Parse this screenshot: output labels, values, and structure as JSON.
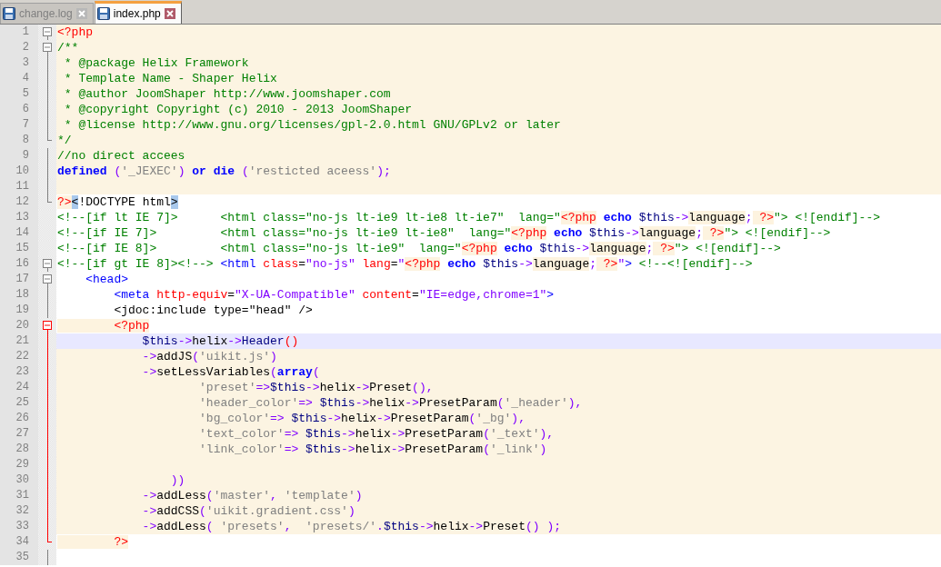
{
  "tabs": [
    {
      "label": "change.log",
      "selected": false
    },
    {
      "label": "index.php",
      "selected": true
    }
  ],
  "lines": [
    {
      "number": "1",
      "kind": "fold-start",
      "fold_active": false,
      "php_block": true,
      "current": false,
      "tokens": [
        {
          "kind": "php-tag",
          "text": "<?php"
        }
      ]
    },
    {
      "number": "2",
      "kind": "fold-start",
      "fold_active": false,
      "php_block": true,
      "current": false,
      "tokens": [
        {
          "kind": "comment",
          "text": "/**"
        }
      ]
    },
    {
      "number": "3",
      "kind": "fold-body",
      "fold_active": false,
      "php_block": true,
      "current": false,
      "tokens": [
        {
          "kind": "comment",
          "text": " * @package Helix Framework"
        }
      ]
    },
    {
      "number": "4",
      "kind": "fold-body",
      "fold_active": false,
      "php_block": true,
      "current": false,
      "tokens": [
        {
          "kind": "comment",
          "text": " * Template Name - Shaper Helix"
        }
      ]
    },
    {
      "number": "5",
      "kind": "fold-body",
      "fold_active": false,
      "php_block": true,
      "current": false,
      "tokens": [
        {
          "kind": "comment",
          "text": " * @author JoomShaper http://www.joomshaper.com"
        }
      ]
    },
    {
      "number": "6",
      "kind": "fold-body",
      "fold_active": false,
      "php_block": true,
      "current": false,
      "tokens": [
        {
          "kind": "comment",
          "text": " * @copyright Copyright (c) 2010 - 2013 JoomShaper"
        }
      ]
    },
    {
      "number": "7",
      "kind": "fold-body",
      "fold_active": false,
      "php_block": true,
      "current": false,
      "tokens": [
        {
          "kind": "comment",
          "text": " * @license http://www.gnu.org/licenses/gpl-2.0.html GNU/GPLv2 or later"
        }
      ]
    },
    {
      "number": "8",
      "kind": "fold-end",
      "fold_active": false,
      "php_block": true,
      "current": false,
      "tokens": [
        {
          "kind": "comment",
          "text": "*/"
        }
      ]
    },
    {
      "number": "9",
      "kind": "fold-body",
      "fold_active": false,
      "php_block": true,
      "current": false,
      "tokens": [
        {
          "kind": "comment",
          "text": "//no direct accees"
        }
      ]
    },
    {
      "number": "10",
      "kind": "fold-body",
      "fold_active": false,
      "php_block": true,
      "current": false,
      "tokens": [
        {
          "kind": "keyword",
          "text": "defined"
        },
        {
          "kind": "operator",
          "text": " ("
        },
        {
          "kind": "string",
          "text": "'_JEXEC'"
        },
        {
          "kind": "operator",
          "text": ")"
        },
        {
          "kind": "keyword",
          "text": " or"
        },
        {
          "kind": "keyword",
          "text": " die"
        },
        {
          "kind": "operator",
          "text": " ("
        },
        {
          "kind": "string",
          "text": "'resticted aceess'"
        },
        {
          "kind": "operator",
          "text": ");"
        }
      ]
    },
    {
      "number": "11",
      "kind": "fold-body",
      "fold_active": false,
      "php_block": true,
      "current": false
    },
    {
      "number": "12",
      "kind": "fold-end",
      "fold_active": false,
      "php_block": false,
      "current": false,
      "tokens": [
        {
          "kind": "php-tag",
          "text": "?>"
        },
        {
          "kind": "bracket-match",
          "text": "<"
        },
        {
          "kind": "plain",
          "text": "!DOCTYPE html"
        },
        {
          "kind": "bracket-match",
          "text": ">"
        }
      ]
    },
    {
      "number": "13",
      "kind": "plain",
      "php_block": false,
      "current": false,
      "tokens": [
        {
          "kind": "comment",
          "text": "<!--[if lt IE 7]>      <html class=\"no-js lt-ie9 lt-ie8 lt-ie7\"  lang=\""
        },
        {
          "kind": "php-tag",
          "text": "<?php"
        },
        {
          "kind": "keyword",
          "text": " echo"
        },
        {
          "kind": "variable",
          "text": " $this"
        },
        {
          "kind": "operator",
          "text": "->"
        },
        {
          "kind": "embedded",
          "text": "language"
        },
        {
          "kind": "operator",
          "text": ";"
        },
        {
          "kind": "php-tag",
          "text": " ?>"
        },
        {
          "kind": "comment",
          "text": "\"> <![endif]-->"
        }
      ]
    },
    {
      "number": "14",
      "kind": "plain",
      "php_block": false,
      "current": false,
      "tokens": [
        {
          "kind": "comment",
          "text": "<!--[if IE 7]>         <html class=\"no-js lt-ie9 lt-ie8\"  lang=\""
        },
        {
          "kind": "php-tag",
          "text": "<?php"
        },
        {
          "kind": "keyword",
          "text": " echo"
        },
        {
          "kind": "variable",
          "text": " $this"
        },
        {
          "kind": "operator",
          "text": "->"
        },
        {
          "kind": "embedded",
          "text": "language"
        },
        {
          "kind": "operator",
          "text": ";"
        },
        {
          "kind": "php-tag",
          "text": " ?>"
        },
        {
          "kind": "comment",
          "text": "\"> <![endif]-->"
        }
      ]
    },
    {
      "number": "15",
      "kind": "plain",
      "php_block": false,
      "current": false,
      "tokens": [
        {
          "kind": "comment",
          "text": "<!--[if IE 8]>         <html class=\"no-js lt-ie9\"  lang=\""
        },
        {
          "kind": "php-tag",
          "text": "<?php"
        },
        {
          "kind": "keyword",
          "text": " echo"
        },
        {
          "kind": "variable",
          "text": " $this"
        },
        {
          "kind": "operator",
          "text": "->"
        },
        {
          "kind": "embedded",
          "text": "language"
        },
        {
          "kind": "operator",
          "text": ";"
        },
        {
          "kind": "php-tag",
          "text": " ?>"
        },
        {
          "kind": "comment",
          "text": "\"> <![endif]-->"
        }
      ]
    },
    {
      "number": "16",
      "kind": "fold-start",
      "fold_active": false,
      "php_block": false,
      "current": false,
      "tokens": [
        {
          "kind": "comment",
          "text": "<!--[if gt IE 8]><!-->"
        },
        {
          "kind": "html-tag",
          "text": " <html"
        },
        {
          "kind": "attr",
          "text": " class"
        },
        {
          "kind": "plain",
          "text": "="
        },
        {
          "kind": "attr-value",
          "text": "\"no-js\""
        },
        {
          "kind": "attr",
          "text": " lang"
        },
        {
          "kind": "plain",
          "text": "="
        },
        {
          "kind": "attr-value",
          "text": "\""
        },
        {
          "kind": "php-tag",
          "text": "<?php"
        },
        {
          "kind": "keyword",
          "text": " echo"
        },
        {
          "kind": "variable",
          "text": " $this"
        },
        {
          "kind": "operator",
          "text": "->"
        },
        {
          "kind": "embedded",
          "text": "language"
        },
        {
          "kind": "operator",
          "text": ";"
        },
        {
          "kind": "php-tag",
          "text": " ?>"
        },
        {
          "kind": "attr-value",
          "text": "\""
        },
        {
          "kind": "html-tag",
          "text": ">"
        },
        {
          "kind": "comment",
          "text": " <!--<![endif]-->"
        }
      ]
    },
    {
      "number": "17",
      "kind": "fold-start",
      "fold_active": false,
      "php_block": false,
      "current": false,
      "tokens": [
        {
          "kind": "html-tag",
          "text": "    <head>"
        }
      ]
    },
    {
      "number": "18",
      "kind": "fold-body",
      "fold_active": false,
      "php_block": false,
      "current": false,
      "tokens": [
        {
          "kind": "html-tag",
          "text": "        <meta"
        },
        {
          "kind": "attr",
          "text": " http-equiv"
        },
        {
          "kind": "plain",
          "text": "="
        },
        {
          "kind": "attr-value",
          "text": "\"X-UA-Compatible\""
        },
        {
          "kind": "attr",
          "text": " content"
        },
        {
          "kind": "plain",
          "text": "="
        },
        {
          "kind": "attr-value",
          "text": "\"IE=edge,chrome=1\""
        },
        {
          "kind": "html-tag",
          "text": ">"
        }
      ]
    },
    {
      "number": "19",
      "kind": "fold-body",
      "fold_active": false,
      "php_block": false,
      "current": false,
      "tokens": [
        {
          "kind": "plain",
          "text": "        <jdoc:include type=\"head\" />"
        }
      ]
    },
    {
      "number": "20",
      "kind": "fold-start",
      "fold_active": true,
      "php_block": false,
      "current": false,
      "tokens": [
        {
          "kind": "php-tag",
          "text": "        <?php"
        }
      ]
    },
    {
      "number": "21",
      "kind": "fold-body",
      "fold_active": true,
      "php_block": true,
      "current": true,
      "tokens": [
        {
          "kind": "variable",
          "text": "            $this"
        },
        {
          "kind": "operator",
          "text": "->"
        },
        {
          "kind": "plain",
          "text": "helix"
        },
        {
          "kind": "operator",
          "text": "->"
        },
        {
          "kind": "variable",
          "text": "Header"
        },
        {
          "kind": "brace-match",
          "text": "()"
        }
      ]
    },
    {
      "number": "22",
      "kind": "fold-body",
      "fold_active": true,
      "php_block": true,
      "current": false,
      "tokens": [
        {
          "kind": "operator",
          "text": "            ->"
        },
        {
          "kind": "plain",
          "text": "addJS"
        },
        {
          "kind": "operator",
          "text": "("
        },
        {
          "kind": "string",
          "text": "'uikit.js'"
        },
        {
          "kind": "operator",
          "text": ")"
        }
      ]
    },
    {
      "number": "23",
      "kind": "fold-body",
      "fold_active": true,
      "php_block": true,
      "current": false,
      "tokens": [
        {
          "kind": "operator",
          "text": "            ->"
        },
        {
          "kind": "plain",
          "text": "setLessVariables"
        },
        {
          "kind": "operator",
          "text": "("
        },
        {
          "kind": "keyword",
          "text": "array"
        },
        {
          "kind": "operator",
          "text": "("
        }
      ]
    },
    {
      "number": "24",
      "kind": "fold-body",
      "fold_active": true,
      "php_block": true,
      "current": false,
      "tokens": [
        {
          "kind": "string",
          "text": "                    'preset'"
        },
        {
          "kind": "operator",
          "text": "=>"
        },
        {
          "kind": "variable",
          "text": "$this"
        },
        {
          "kind": "operator",
          "text": "->"
        },
        {
          "kind": "plain",
          "text": "helix"
        },
        {
          "kind": "operator",
          "text": "->"
        },
        {
          "kind": "plain",
          "text": "Preset"
        },
        {
          "kind": "operator",
          "text": "(),"
        }
      ]
    },
    {
      "number": "25",
      "kind": "fold-body",
      "fold_active": true,
      "php_block": true,
      "current": false,
      "tokens": [
        {
          "kind": "string",
          "text": "                    'header_color'"
        },
        {
          "kind": "operator",
          "text": "=>"
        },
        {
          "kind": "variable",
          "text": " $this"
        },
        {
          "kind": "operator",
          "text": "->"
        },
        {
          "kind": "plain",
          "text": "helix"
        },
        {
          "kind": "operator",
          "text": "->"
        },
        {
          "kind": "plain",
          "text": "PresetParam"
        },
        {
          "kind": "operator",
          "text": "("
        },
        {
          "kind": "string",
          "text": "'_header'"
        },
        {
          "kind": "operator",
          "text": "),"
        }
      ]
    },
    {
      "number": "26",
      "kind": "fold-body",
      "fold_active": true,
      "php_block": true,
      "current": false,
      "tokens": [
        {
          "kind": "string",
          "text": "                    'bg_color'"
        },
        {
          "kind": "operator",
          "text": "=>"
        },
        {
          "kind": "variable",
          "text": " $this"
        },
        {
          "kind": "operator",
          "text": "->"
        },
        {
          "kind": "plain",
          "text": "helix"
        },
        {
          "kind": "operator",
          "text": "->"
        },
        {
          "kind": "plain",
          "text": "PresetParam"
        },
        {
          "kind": "operator",
          "text": "("
        },
        {
          "kind": "string",
          "text": "'_bg'"
        },
        {
          "kind": "operator",
          "text": "),"
        }
      ]
    },
    {
      "number": "27",
      "kind": "fold-body",
      "fold_active": true,
      "php_block": true,
      "current": false,
      "tokens": [
        {
          "kind": "string",
          "text": "                    'text_color'"
        },
        {
          "kind": "operator",
          "text": "=>"
        },
        {
          "kind": "variable",
          "text": " $this"
        },
        {
          "kind": "operator",
          "text": "->"
        },
        {
          "kind": "plain",
          "text": "helix"
        },
        {
          "kind": "operator",
          "text": "->"
        },
        {
          "kind": "plain",
          "text": "PresetParam"
        },
        {
          "kind": "operator",
          "text": "("
        },
        {
          "kind": "string",
          "text": "'_text'"
        },
        {
          "kind": "operator",
          "text": "),"
        }
      ]
    },
    {
      "number": "28",
      "kind": "fold-body",
      "fold_active": true,
      "php_block": true,
      "current": false,
      "tokens": [
        {
          "kind": "string",
          "text": "                    'link_color'"
        },
        {
          "kind": "operator",
          "text": "=>"
        },
        {
          "kind": "variable",
          "text": " $this"
        },
        {
          "kind": "operator",
          "text": "->"
        },
        {
          "kind": "plain",
          "text": "helix"
        },
        {
          "kind": "operator",
          "text": "->"
        },
        {
          "kind": "plain",
          "text": "PresetParam"
        },
        {
          "kind": "operator",
          "text": "("
        },
        {
          "kind": "string",
          "text": "'_link'"
        },
        {
          "kind": "operator",
          "text": ")"
        }
      ]
    },
    {
      "number": "29",
      "kind": "fold-body",
      "fold_active": true,
      "php_block": true,
      "current": false
    },
    {
      "number": "30",
      "kind": "fold-body",
      "fold_active": true,
      "php_block": true,
      "current": false,
      "tokens": [
        {
          "kind": "operator",
          "text": "                ))"
        }
      ]
    },
    {
      "number": "31",
      "kind": "fold-body",
      "fold_active": true,
      "php_block": true,
      "current": false,
      "tokens": [
        {
          "kind": "operator",
          "text": "            ->"
        },
        {
          "kind": "plain",
          "text": "addLess"
        },
        {
          "kind": "operator",
          "text": "("
        },
        {
          "kind": "string",
          "text": "'master'"
        },
        {
          "kind": "operator",
          "text": ","
        },
        {
          "kind": "string",
          "text": " 'template'"
        },
        {
          "kind": "operator",
          "text": ")"
        }
      ]
    },
    {
      "number": "32",
      "kind": "fold-body",
      "fold_active": true,
      "php_block": true,
      "current": false,
      "tokens": [
        {
          "kind": "operator",
          "text": "            ->"
        },
        {
          "kind": "plain",
          "text": "addCSS"
        },
        {
          "kind": "operator",
          "text": "("
        },
        {
          "kind": "string",
          "text": "'uikit.gradient.css'"
        },
        {
          "kind": "operator",
          "text": ")"
        }
      ]
    },
    {
      "number": "33",
      "kind": "fold-body",
      "fold_active": true,
      "php_block": true,
      "current": false,
      "tokens": [
        {
          "kind": "operator",
          "text": "            ->"
        },
        {
          "kind": "plain",
          "text": "addLess"
        },
        {
          "kind": "operator",
          "text": "("
        },
        {
          "kind": "string",
          "text": " 'presets'"
        },
        {
          "kind": "operator",
          "text": ","
        },
        {
          "kind": "string",
          "text": "  'presets/'"
        },
        {
          "kind": "operator",
          "text": "."
        },
        {
          "kind": "variable",
          "text": "$this"
        },
        {
          "kind": "operator",
          "text": "->"
        },
        {
          "kind": "plain",
          "text": "helix"
        },
        {
          "kind": "operator",
          "text": "->"
        },
        {
          "kind": "plain",
          "text": "Preset"
        },
        {
          "kind": "operator",
          "text": "()"
        },
        {
          "kind": "operator",
          "text": " );"
        }
      ]
    },
    {
      "number": "34",
      "kind": "fold-end",
      "fold_active": true,
      "php_block": false,
      "current": false,
      "tokens": [
        {
          "kind": "php-tag",
          "text": "        ?>"
        }
      ]
    },
    {
      "number": "35",
      "kind": "fold-body",
      "fold_active": false
    }
  ]
}
